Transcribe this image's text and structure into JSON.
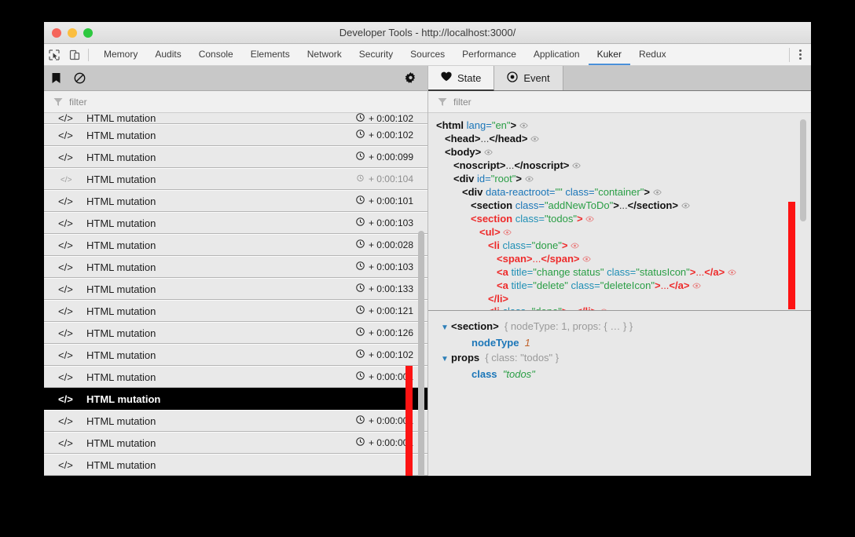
{
  "window": {
    "title": "Developer Tools - http://localhost:3000/",
    "traffic_lights": [
      "close",
      "minimize",
      "zoom"
    ],
    "colors": {
      "red": "#f5655b",
      "yellow": "#fbbe3f",
      "green": "#2dc83f",
      "accent": "#4a90d9",
      "highlight": "#fd1313"
    }
  },
  "devtools_tabs": {
    "items": [
      {
        "label": "Memory",
        "active": false
      },
      {
        "label": "Audits",
        "active": false
      },
      {
        "label": "Console",
        "active": false
      },
      {
        "label": "Elements",
        "active": false
      },
      {
        "label": "Network",
        "active": false
      },
      {
        "label": "Security",
        "active": false
      },
      {
        "label": "Sources",
        "active": false
      },
      {
        "label": "Performance",
        "active": false
      },
      {
        "label": "Application",
        "active": false
      },
      {
        "label": "Kuker",
        "active": true
      },
      {
        "label": "Redux",
        "active": false
      }
    ]
  },
  "left_panel": {
    "toolbar": {
      "bookmark_icon": "bookmark-icon",
      "clear_icon": "clear-icon",
      "settings_icon": "gear-icon"
    },
    "filter": {
      "placeholder": "filter",
      "value": "",
      "icon": "funnel-icon"
    },
    "rows": [
      {
        "label": "HTML mutation",
        "time": "+ 0:00:102",
        "selected": false,
        "dim": false,
        "partial": true
      },
      {
        "label": "HTML mutation",
        "time": "+ 0:00:102",
        "selected": false,
        "dim": false
      },
      {
        "label": "HTML mutation",
        "time": "+ 0:00:099",
        "selected": false,
        "dim": false
      },
      {
        "label": "HTML mutation",
        "time": "+ 0:00:104",
        "selected": false,
        "dim": true
      },
      {
        "label": "HTML mutation",
        "time": "+ 0:00:101",
        "selected": false,
        "dim": false
      },
      {
        "label": "HTML mutation",
        "time": "+ 0:00:103",
        "selected": false,
        "dim": false
      },
      {
        "label": "HTML mutation",
        "time": "+ 0:00:028",
        "selected": false,
        "dim": false
      },
      {
        "label": "HTML mutation",
        "time": "+ 0:00:103",
        "selected": false,
        "dim": false
      },
      {
        "label": "HTML mutation",
        "time": "+ 0:00:133",
        "selected": false,
        "dim": false
      },
      {
        "label": "HTML mutation",
        "time": "+ 0:00:121",
        "selected": false,
        "dim": false
      },
      {
        "label": "HTML mutation",
        "time": "+ 0:00:126",
        "selected": false,
        "dim": false
      },
      {
        "label": "HTML mutation",
        "time": "+ 0:00:102",
        "selected": false,
        "dim": false
      },
      {
        "label": "HTML mutation",
        "time": "+ 0:00:001",
        "selected": false,
        "dim": false
      },
      {
        "label": "HTML mutation",
        "time": "",
        "selected": true,
        "dim": false
      },
      {
        "label": "HTML mutation",
        "time": "+ 0:00:001",
        "selected": false,
        "dim": false
      },
      {
        "label": "HTML mutation",
        "time": "+ 0:00:001",
        "selected": false,
        "dim": false
      },
      {
        "label": "HTML mutation",
        "time": "",
        "selected": false,
        "dim": false
      }
    ]
  },
  "right_panel": {
    "tabs": [
      {
        "label": "State",
        "icon": "heart-icon",
        "active": true
      },
      {
        "label": "Event",
        "icon": "record-icon",
        "active": false
      }
    ],
    "filter": {
      "placeholder": "filter",
      "value": "",
      "icon": "funnel-icon"
    },
    "dom_tree": [
      {
        "indent": 0,
        "highlight": false,
        "eye": true,
        "parts": [
          [
            "tag",
            "<html "
          ],
          [
            "attr",
            "lang="
          ],
          [
            "val",
            "\"en\""
          ],
          [
            "tag",
            ">"
          ]
        ]
      },
      {
        "indent": 1,
        "highlight": false,
        "eye": true,
        "parts": [
          [
            "tag",
            "<head>"
          ],
          [
            "txt",
            "..."
          ],
          [
            "tag",
            "</head>"
          ]
        ]
      },
      {
        "indent": 1,
        "highlight": false,
        "eye": true,
        "parts": [
          [
            "tag",
            "<body>"
          ]
        ]
      },
      {
        "indent": 2,
        "highlight": false,
        "eye": true,
        "parts": [
          [
            "tag",
            "<noscript>"
          ],
          [
            "txt",
            "..."
          ],
          [
            "tag",
            "</noscript>"
          ]
        ]
      },
      {
        "indent": 2,
        "highlight": false,
        "eye": true,
        "parts": [
          [
            "tag",
            "<div "
          ],
          [
            "attr",
            "id="
          ],
          [
            "val",
            "\"root\""
          ],
          [
            "tag",
            ">"
          ]
        ]
      },
      {
        "indent": 3,
        "highlight": false,
        "eye": true,
        "parts": [
          [
            "tag",
            "<div "
          ],
          [
            "attr",
            "data-reactroot="
          ],
          [
            "val",
            "\"\""
          ],
          [
            "attr",
            " class="
          ],
          [
            "val",
            "\"container\""
          ],
          [
            "tag",
            ">"
          ]
        ]
      },
      {
        "indent": 4,
        "highlight": false,
        "eye": true,
        "parts": [
          [
            "tag",
            "<section "
          ],
          [
            "attr",
            "class="
          ],
          [
            "val",
            "\"addNewToDo\""
          ],
          [
            "tag",
            ">"
          ],
          [
            "txt",
            "..."
          ],
          [
            "tag",
            "</section>"
          ]
        ]
      },
      {
        "indent": 4,
        "highlight": true,
        "eye": true,
        "parts": [
          [
            "tag",
            "<section "
          ],
          [
            "attr",
            "class="
          ],
          [
            "val",
            "\"todos\""
          ],
          [
            "tag",
            ">"
          ]
        ]
      },
      {
        "indent": 5,
        "highlight": true,
        "eye": true,
        "parts": [
          [
            "tag",
            "<ul>"
          ]
        ]
      },
      {
        "indent": 6,
        "highlight": true,
        "eye": true,
        "parts": [
          [
            "tag",
            "<li "
          ],
          [
            "attr",
            "class="
          ],
          [
            "val",
            "\"done\""
          ],
          [
            "tag",
            ">"
          ]
        ]
      },
      {
        "indent": 7,
        "highlight": true,
        "eye": true,
        "parts": [
          [
            "tag",
            "<span>"
          ],
          [
            "txt",
            "..."
          ],
          [
            "tag",
            "</span>"
          ]
        ]
      },
      {
        "indent": 7,
        "highlight": true,
        "eye": true,
        "parts": [
          [
            "tag",
            "<a "
          ],
          [
            "attr",
            "title="
          ],
          [
            "val",
            "\"change status\""
          ],
          [
            "attr",
            " class="
          ],
          [
            "val",
            "\"statusIcon\""
          ],
          [
            "tag",
            ">"
          ],
          [
            "txt",
            "..."
          ],
          [
            "tag",
            "</a>"
          ]
        ]
      },
      {
        "indent": 7,
        "highlight": true,
        "eye": true,
        "parts": [
          [
            "tag",
            "<a "
          ],
          [
            "attr",
            "title="
          ],
          [
            "val",
            "\"delete\""
          ],
          [
            "attr",
            " class="
          ],
          [
            "val",
            "\"deleteIcon\""
          ],
          [
            "tag",
            ">"
          ],
          [
            "txt",
            "..."
          ],
          [
            "tag",
            "</a>"
          ]
        ]
      },
      {
        "indent": 6,
        "highlight": true,
        "eye": false,
        "parts": [
          [
            "tag",
            "</li>"
          ]
        ]
      },
      {
        "indent": 6,
        "highlight": true,
        "eye": true,
        "parts": [
          [
            "tag",
            "<li "
          ],
          [
            "attr",
            "class="
          ],
          [
            "val",
            "\"done\""
          ],
          [
            "tag",
            ">"
          ],
          [
            "txt",
            "..."
          ],
          [
            "tag",
            "</li>"
          ]
        ]
      }
    ],
    "detail_tree": [
      {
        "indent": 0,
        "arrow": "▼",
        "key": "<section>",
        "key_style": "bold",
        "preview": "{ nodeType: 1, props: { … } }",
        "value": "",
        "value_type": ""
      },
      {
        "indent": 1,
        "arrow": "",
        "key": "nodeType",
        "key_style": "key",
        "preview": "",
        "value": "1",
        "value_type": "number"
      },
      {
        "indent": 0,
        "arrow": "▼",
        "key": "props",
        "key_style": "bold",
        "preview": "{ class: \"todos\" }",
        "value": "",
        "value_type": ""
      },
      {
        "indent": 1,
        "arrow": "",
        "key": "class",
        "key_style": "key",
        "preview": "",
        "value": "\"todos\"",
        "value_type": "string"
      }
    ]
  }
}
